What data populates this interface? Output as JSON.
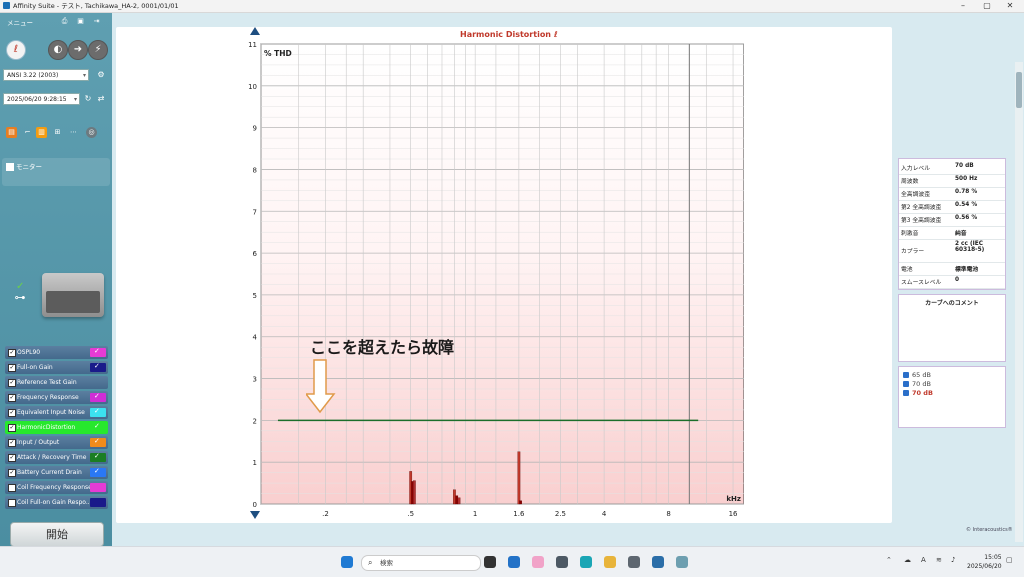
{
  "window": {
    "title": "Affinity Suite - テスト, Tachikawa_HA-2, 0001/01/01",
    "minimize_label": "–",
    "maximize_label": "▢",
    "close_label": "✕"
  },
  "sidebar": {
    "menu_label": "メニュー",
    "standard_select": "ANSI 3.22 (2003)",
    "datetime_select": "2025/06/20 9:28:15",
    "monitor_label": "モニター",
    "tests": [
      {
        "label": "OSPL90",
        "checked": true,
        "color": "#e53bd5"
      },
      {
        "label": "Full-on Gain",
        "checked": true,
        "color": "#1a1a8a"
      },
      {
        "label": "Reference Test Gain",
        "checked": true,
        "color": ""
      },
      {
        "label": "Frequency Response",
        "checked": true,
        "color": "#d02ed6"
      },
      {
        "label": "Equivalent Input Noise",
        "checked": true,
        "color": "#3be1ef"
      },
      {
        "label": "HarmonicDistortion",
        "checked": true,
        "color": "#27e82d"
      },
      {
        "label": "Input / Output",
        "checked": true,
        "color": "#f08b1b"
      },
      {
        "label": "Attack / Recovery Time",
        "checked": true,
        "color": "#1b7e23"
      },
      {
        "label": "Battery Current Drain",
        "checked": true,
        "color": "#2a78f5"
      },
      {
        "label": "Coil Frequency Response",
        "checked": false,
        "color": "#e53bd5"
      },
      {
        "label": "Coil Full-on Gain Respo...",
        "checked": false,
        "color": "#1a1a8a"
      }
    ],
    "start_button": "開始"
  },
  "chart": {
    "title": "Harmonic Distortion",
    "annotation": "ここを超えたら故障",
    "accent": "#c0392b",
    "limit_color": "#1b6e2a"
  },
  "chart_data": {
    "type": "bar",
    "title": "Harmonic Distortion",
    "ylabel": "% THD",
    "xlabel": "kHz",
    "x_scale": "log",
    "y_ticks": [
      "0",
      "1",
      "2",
      "3",
      "4",
      "5",
      "6",
      "7",
      "8",
      "9",
      "10",
      "11"
    ],
    "x_ticks": [
      ".2",
      ".5",
      "1",
      "1.6",
      "2.5",
      "4",
      "8",
      "16"
    ],
    "ylim": [
      0,
      11
    ],
    "xlim": [
      0.1,
      18
    ],
    "limit_line": {
      "value": 2,
      "x_range": [
        0.12,
        11
      ]
    },
    "series": [
      {
        "name": "65 dB",
        "x": [
          0.5,
          0.8,
          1.6
        ],
        "values": [
          0.78,
          0.34,
          1.25
        ],
        "color": "#c0392b"
      },
      {
        "name": "70 dB",
        "x": [
          0.51,
          0.82,
          1.63
        ],
        "values": [
          0.54,
          0.2,
          0.08
        ],
        "color": "#8b0000"
      },
      {
        "name": "70 dB",
        "x": [
          0.52,
          0.84
        ],
        "values": [
          0.56,
          0.15
        ],
        "color": "#b03030"
      }
    ]
  },
  "info": {
    "rows": [
      {
        "key": "入力レベル",
        "value": "70 dB"
      },
      {
        "key": "周波数",
        "value": "500 Hz"
      },
      {
        "key": "全高調波歪",
        "value": "0.78 %"
      },
      {
        "key": "第2 全高調波歪",
        "value": "0.54 %"
      },
      {
        "key": "第3 全高調波歪",
        "value": "0.56 %"
      },
      {
        "key": "刺激音",
        "value": "純音"
      },
      {
        "key": "カプラー",
        "value": "2 cc (IEC 60318-5)"
      },
      {
        "key": "電池",
        "value": "標準電池"
      },
      {
        "key": "スムースレベル",
        "value": "0"
      }
    ],
    "comment_title": "カーブへのコメント"
  },
  "legend": {
    "items": [
      "65 dB",
      "70 dB",
      "70 dB"
    ]
  },
  "brand": "© Interacoustics®",
  "taskbar": {
    "search_placeholder": "検索",
    "time": "15:05",
    "date": "2025/06/20"
  }
}
